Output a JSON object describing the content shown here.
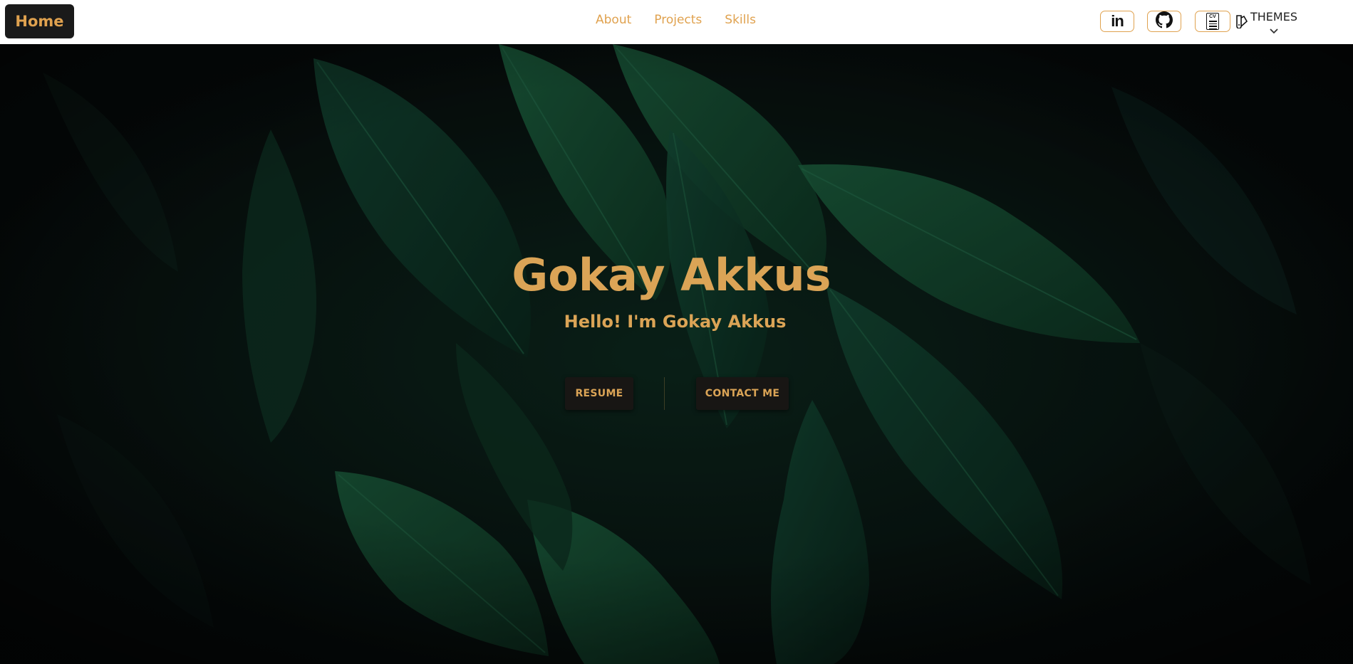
{
  "nav": {
    "home_label": "Home",
    "links": [
      {
        "label": "About"
      },
      {
        "label": "Projects"
      },
      {
        "label": "Skills"
      }
    ],
    "social": [
      {
        "name": "linkedin-icon",
        "text": "in"
      },
      {
        "name": "github-icon"
      },
      {
        "name": "cv-icon",
        "text": "CV"
      }
    ],
    "themes_label": "THEMES"
  },
  "hero": {
    "title": "Gokay Akkus",
    "subtitle": "Hello! I'm Gokay Akkus",
    "resume_label": "RESUME",
    "contact_label": "CONTACT ME"
  },
  "colors": {
    "accent": "#dba456",
    "nav_bg": "#ffffff",
    "dark": "#1a1a1a",
    "leaf_green": "#1a5a3a"
  }
}
